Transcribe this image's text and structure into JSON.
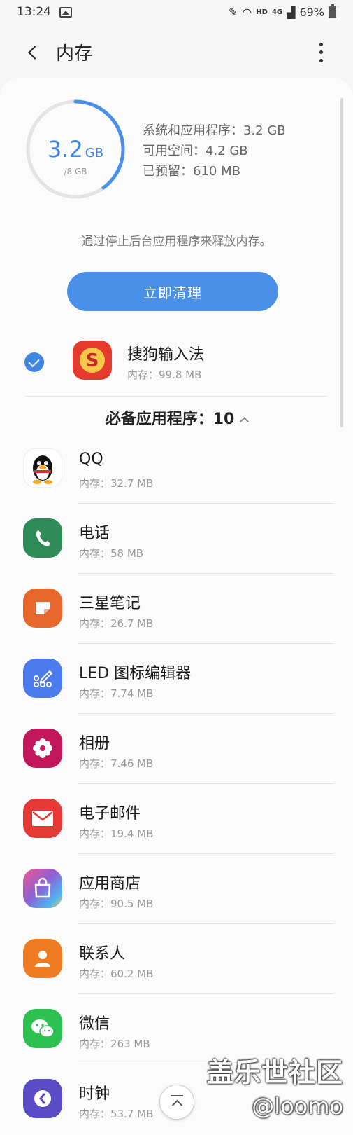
{
  "status_bar": {
    "time": "13:24",
    "network": "4G",
    "hd": "HD",
    "battery": "69%"
  },
  "app_bar": {
    "title": "内存"
  },
  "memory": {
    "used_value": "3.2",
    "used_unit": "GB",
    "total": "/8 GB",
    "used_fraction": 0.4,
    "stats": {
      "system_apps": "系统和应用程序：3.2 GB",
      "available": "可用空间：4.2 GB",
      "reserved": "已预留：610 MB"
    },
    "hint": "通过停止后台应用程序来释放内存。",
    "clean_button": "立即清理"
  },
  "selected_app": {
    "name": "搜狗输入法",
    "memory": "内存：99.8 MB",
    "icon": "sogou-icon",
    "checked": true
  },
  "section": {
    "title": "必备应用程序：10"
  },
  "apps": [
    {
      "name": "QQ",
      "memory": "内存：32.7 MB",
      "icon": "qq-penguin-icon",
      "color": "#ffffff"
    },
    {
      "name": "电话",
      "memory": "内存：58 MB",
      "icon": "phone-icon",
      "color": "#2e8b57"
    },
    {
      "name": "三星笔记",
      "memory": "内存：26.7 MB",
      "icon": "samsung-notes-icon",
      "color": "#e8672c"
    },
    {
      "name": "LED 图标编辑器",
      "memory": "内存：7.74 MB",
      "icon": "led-editor-icon",
      "color": "#4b7bec"
    },
    {
      "name": "相册",
      "memory": "内存：7.46 MB",
      "icon": "gallery-icon",
      "color": "#c2185b"
    },
    {
      "name": "电子邮件",
      "memory": "内存：19.4 MB",
      "icon": "email-icon",
      "color": "#e53935"
    },
    {
      "name": "应用商店",
      "memory": "内存：90.5 MB",
      "icon": "galaxy-store-icon",
      "color": "#8e5fd4"
    },
    {
      "name": "联系人",
      "memory": "内存：60.2 MB",
      "icon": "contacts-icon",
      "color": "#ef7b22"
    },
    {
      "name": "微信",
      "memory": "内存：263 MB",
      "icon": "wechat-icon",
      "color": "#2dc152"
    },
    {
      "name": "时钟",
      "memory": "内存：53.7 MB",
      "icon": "clock-icon",
      "color": "#5b4bc4"
    }
  ],
  "watermark": {
    "text": "盖乐世社区",
    "handle": "@loomo"
  }
}
